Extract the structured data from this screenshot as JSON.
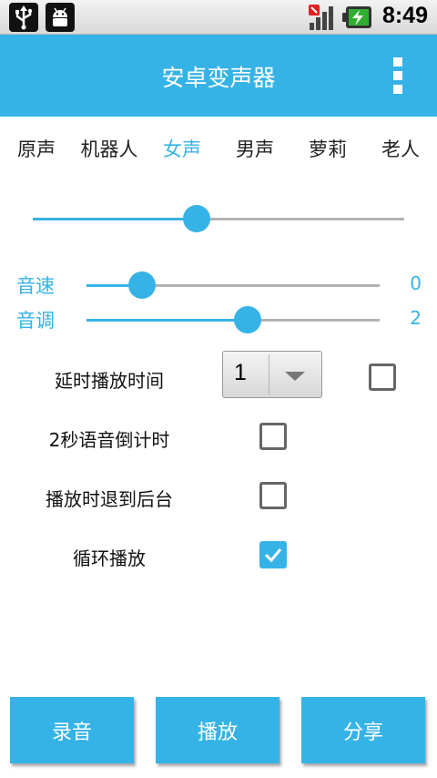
{
  "status_bar": {
    "time": "8:49",
    "icons": [
      "usb-icon",
      "android-debug-icon",
      "signal-icon",
      "battery-charging-icon"
    ]
  },
  "app": {
    "title": "安卓变声器",
    "menu_icon": "overflow-menu-icon"
  },
  "voice_tabs": {
    "items": [
      "原声",
      "机器人",
      "女声",
      "男声",
      "萝莉",
      "老人"
    ],
    "selected": "女声"
  },
  "main_slider": {
    "level": 0.44
  },
  "speed": {
    "label": "音速",
    "value": "0",
    "level": 0.19
  },
  "pitch": {
    "label": "音调",
    "value": "2",
    "level": 0.55
  },
  "options": {
    "delay_label": "延时播放时间",
    "delay_value": "1",
    "delay_checked": false,
    "countdown_label": "2秒语音倒计时",
    "countdown_checked": false,
    "background_label": "播放时退到后台",
    "background_checked": false,
    "loop_label": "循环播放",
    "loop_checked": true
  },
  "buttons": {
    "record": "录音",
    "play": "播放",
    "share": "分享"
  },
  "colors": {
    "accent": "#36b3e6",
    "track": "#b3b3b3"
  }
}
